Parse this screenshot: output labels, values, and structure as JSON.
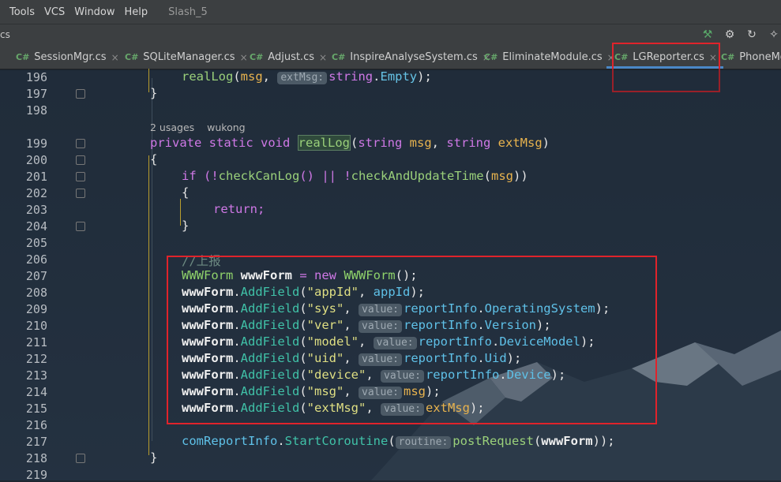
{
  "menu": {
    "items": [
      "Tools",
      "VCS",
      "Window",
      "Help"
    ],
    "project": "Slash_5"
  },
  "navbar": {
    "crumb": "cs"
  },
  "tabs": [
    {
      "lang": "C#",
      "label": "SessionMgr.cs"
    },
    {
      "lang": "C#",
      "label": "SQLiteManager.cs"
    },
    {
      "lang": "C#",
      "label": "Adjust.cs"
    },
    {
      "lang": "C#",
      "label": "InspireAnalyseSystem.cs"
    },
    {
      "lang": "C#",
      "label": "EliminateModule.cs"
    },
    {
      "lang": "C#",
      "label": "LGReporter.cs",
      "active": true
    },
    {
      "lang": "C#",
      "label": "PhoneMgr"
    }
  ],
  "tab_close_glyph": "×",
  "line_numbers": [
    "196",
    "197",
    "198",
    "199",
    "200",
    "201",
    "202",
    "203",
    "204",
    "205",
    "206",
    "207",
    "208",
    "209",
    "210",
    "211",
    "212",
    "213",
    "214",
    "215",
    "216",
    "217",
    "218",
    "219"
  ],
  "meta": {
    "usages": "2 usages",
    "author": "wukong"
  },
  "hints": {
    "extMsg": "extMsg:",
    "value": "value:",
    "routine": "routine:"
  },
  "code": {
    "l196": [
      "realLog",
      "(",
      "msg",
      ", ",
      "string",
      ".",
      "Empty",
      ");"
    ],
    "l197": "}",
    "l199": [
      "private ",
      "static ",
      "void ",
      "realLog",
      "(",
      "string ",
      "msg",
      ", ",
      "string ",
      "extMsg",
      ")"
    ],
    "l200": "{",
    "l201": [
      "if (!",
      "checkCanLog",
      "() || !",
      "checkAndUpdateTime",
      "(",
      "msg",
      "))"
    ],
    "l202": "{",
    "l203": "return;",
    "l204": "}",
    "l206": "//上报",
    "l207": [
      "WWWForm ",
      "wwwForm",
      " = ",
      "new ",
      "WWWForm",
      "();"
    ],
    "fields": [
      {
        "key": "\"appId\"",
        "hint": false,
        "obj": "",
        "val": "appId"
      },
      {
        "key": "\"sys\"",
        "hint": true,
        "obj": "reportInfo",
        "val": "OperatingSystem"
      },
      {
        "key": "\"ver\"",
        "hint": true,
        "obj": "reportInfo",
        "val": "Version"
      },
      {
        "key": "\"model\"",
        "hint": true,
        "obj": "reportInfo",
        "val": "DeviceModel"
      },
      {
        "key": "\"uid\"",
        "hint": true,
        "obj": "reportInfo",
        "val": "Uid"
      },
      {
        "key": "\"device\"",
        "hint": true,
        "obj": "reportInfo",
        "val": "Device"
      },
      {
        "key": "\"msg\"",
        "hint": true,
        "obj": "",
        "val": "msg"
      },
      {
        "key": "\"extMsg\"",
        "hint": true,
        "obj": "",
        "val": "extMsg"
      }
    ],
    "field_obj": "wwwForm",
    "field_method": "AddField",
    "l217": [
      "comReportInfo",
      ".",
      "StartCoroutine",
      "(",
      "postRequest",
      "(",
      "wwwForm",
      "));"
    ],
    "l218": "}"
  }
}
